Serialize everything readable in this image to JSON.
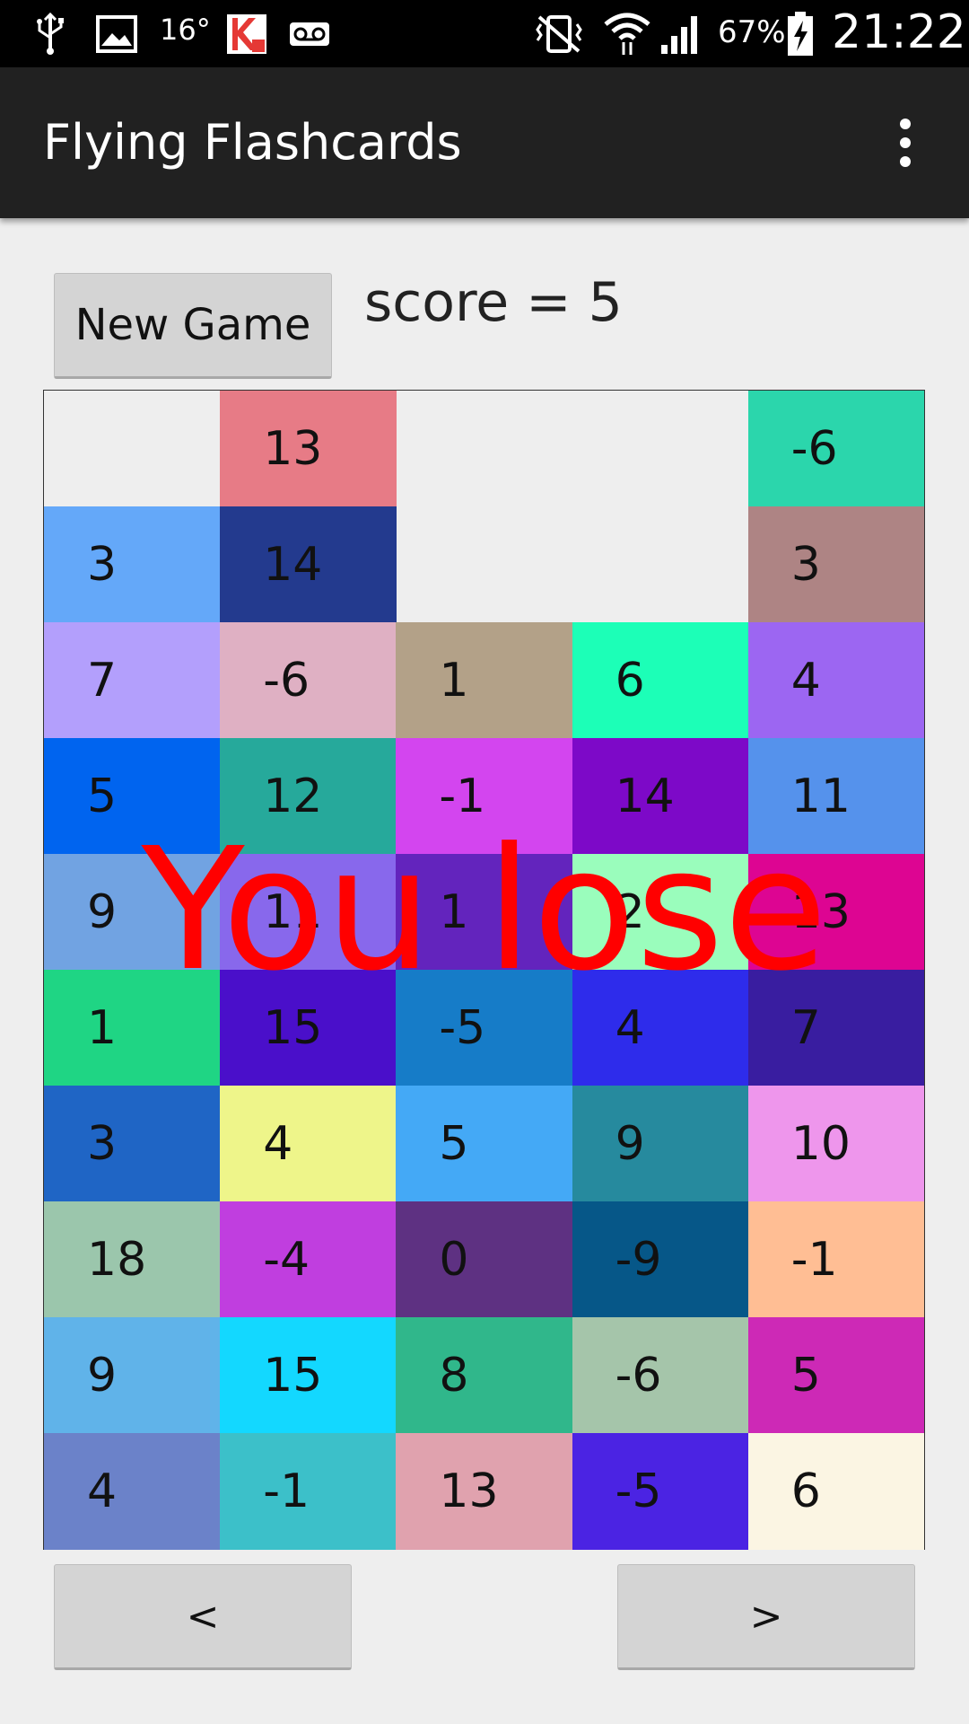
{
  "status_bar": {
    "temperature": "16°",
    "battery_percent": "67%",
    "clock": "21:22",
    "left_icons": [
      "usb-icon",
      "image-icon",
      "kaspersky-icon",
      "voicemail-icon"
    ],
    "right_icons": [
      "vibrate-icon",
      "wifi-icon",
      "signal-icon",
      "battery-charging-icon"
    ]
  },
  "app_bar": {
    "title": "Flying Flashcards",
    "overflow_icon": "more-vert-icon"
  },
  "controls": {
    "new_game_label": "New Game",
    "score_text": "score = 5",
    "prev_label": "<",
    "next_label": ">"
  },
  "game": {
    "message": "You lose",
    "message_color": "#ff0000",
    "columns": 5,
    "rows": 10,
    "grid": [
      [
        null,
        {
          "value": "13",
          "color": "#e77b86"
        },
        null,
        null,
        {
          "value": "-6",
          "color": "#2bd6ac"
        }
      ],
      [
        {
          "value": "3",
          "color": "#64a8f9"
        },
        {
          "value": "14",
          "color": "#233a8e"
        },
        null,
        null,
        {
          "value": "3",
          "color": "#ae8484"
        }
      ],
      [
        {
          "value": "7",
          "color": "#b39ffc"
        },
        {
          "value": "-6",
          "color": "#dfb0c3"
        },
        {
          "value": "1",
          "color": "#b3a188"
        },
        {
          "value": "6",
          "color": "#1cffb7"
        },
        {
          "value": "4",
          "color": "#9c66f2"
        }
      ],
      [
        {
          "value": "5",
          "color": "#0064ef"
        },
        {
          "value": "12",
          "color": "#26a99b"
        },
        {
          "value": "-1",
          "color": "#d345ef"
        },
        {
          "value": "14",
          "color": "#7d09c8"
        },
        {
          "value": "11",
          "color": "#5592ec"
        }
      ],
      [
        {
          "value": "9",
          "color": "#71a3e2"
        },
        {
          "value": "11",
          "color": "#8868ec"
        },
        {
          "value": "1",
          "color": "#6324bd"
        },
        {
          "value": "2",
          "color": "#9afdbc"
        },
        {
          "value": "13",
          "color": "#dd0592"
        }
      ],
      [
        {
          "value": "1",
          "color": "#1fd584"
        },
        {
          "value": "15",
          "color": "#4a0fca"
        },
        {
          "value": "-5",
          "color": "#167cc8"
        },
        {
          "value": "4",
          "color": "#2e2ceb"
        },
        {
          "value": "7",
          "color": "#391da0"
        }
      ],
      [
        {
          "value": "3",
          "color": "#1f65c5"
        },
        {
          "value": "4",
          "color": "#eef58a"
        },
        {
          "value": "5",
          "color": "#44a9f6"
        },
        {
          "value": "9",
          "color": "#268a9e"
        },
        {
          "value": "10",
          "color": "#ee96ec"
        }
      ],
      [
        {
          "value": "18",
          "color": "#9bc6ac"
        },
        {
          "value": "-4",
          "color": "#c03edf"
        },
        {
          "value": "0",
          "color": "#5e3182"
        },
        {
          "value": "-9",
          "color": "#065788"
        },
        {
          "value": "-1",
          "color": "#ffbe94"
        }
      ],
      [
        {
          "value": "9",
          "color": "#60b3e9"
        },
        {
          "value": "15",
          "color": "#13d8ff"
        },
        {
          "value": "8",
          "color": "#30b78b"
        },
        {
          "value": "-6",
          "color": "#a5c5aa"
        },
        {
          "value": "5",
          "color": "#cd29b6"
        }
      ],
      [
        {
          "value": "4",
          "color": "#6b82c9"
        },
        {
          "value": "-1",
          "color": "#3cc0c9"
        },
        {
          "value": "13",
          "color": "#e0a2ae"
        },
        {
          "value": "-5",
          "color": "#4b23e3"
        },
        {
          "value": "6",
          "color": "#fbf5e3"
        }
      ]
    ]
  }
}
